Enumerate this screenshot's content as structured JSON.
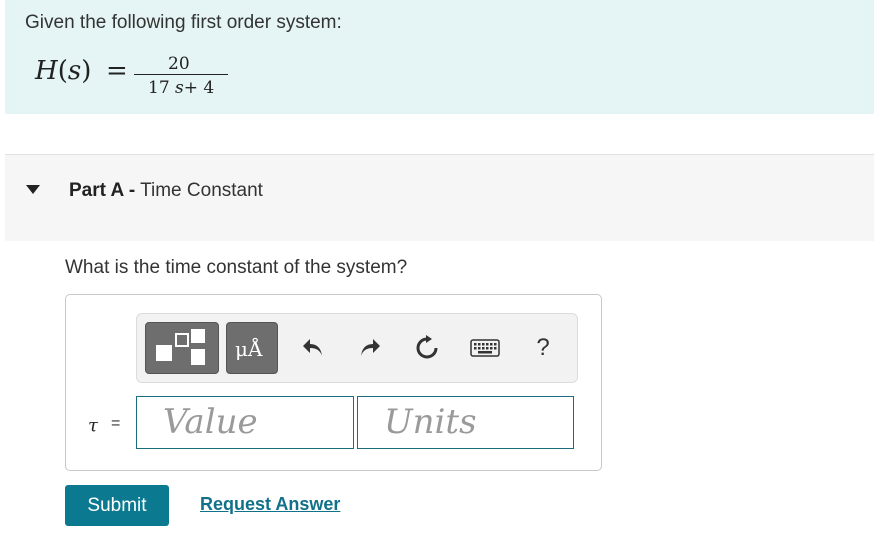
{
  "intro": {
    "text": "Given the following first order system:",
    "equation": {
      "lhs_fn": "H",
      "lhs_arg": "s",
      "numerator": "20",
      "den_coef": "17",
      "den_var": "s",
      "den_rest": "+ 4"
    }
  },
  "part_a": {
    "label": "Part A -",
    "title": "Time Constant",
    "question": "What is the time constant of the system?"
  },
  "toolbar": {
    "symbols_label": "μÅ",
    "help_label": "?"
  },
  "answer": {
    "variable": "τ",
    "equals": "=",
    "value_placeholder": "Value",
    "units_placeholder": "Units"
  },
  "actions": {
    "submit_label": "Submit",
    "request_label": "Request Answer"
  },
  "colors": {
    "intro_bg": "#e5f4f5",
    "accent": "#0b7a91",
    "link": "#11708a",
    "field_border": "#1a6e7e"
  }
}
